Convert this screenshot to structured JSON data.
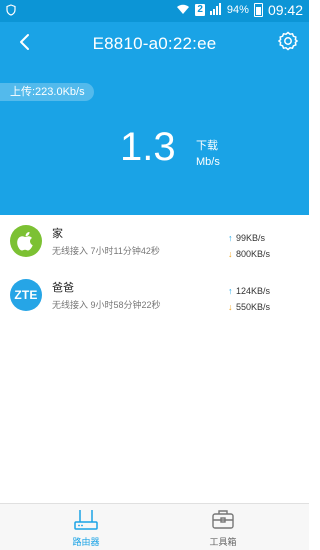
{
  "status_bar": {
    "sim_slot": "2",
    "battery": "94%",
    "time": "09:42"
  },
  "header": {
    "title": "E8810-a0:22:ee"
  },
  "hero": {
    "upload_text": "上传:223.0Kb/s",
    "download_value": "1.3",
    "download_label": "下载",
    "download_unit": "Mb/s"
  },
  "devices": [
    {
      "name": "家",
      "detail": "无线接入  7小时11分钟42秒",
      "up": "99KB/s",
      "down": "800KB/s",
      "icon": "apple-icon"
    },
    {
      "name": "爸爸",
      "detail": "无线接入  9小时58分钟22秒",
      "up": "124KB/s",
      "down": "550KB/s",
      "icon": "zte-logo",
      "logo_text": "ZTE"
    }
  ],
  "bottom_nav": {
    "router_label": "路由器",
    "toolbox_label": "工具箱"
  },
  "colors": {
    "primary": "#1aa3e6",
    "status_bar": "#0c95d6",
    "apple_green": "#7cc133",
    "upload_arrow": "#1aa3e6",
    "download_arrow": "#f2a31b"
  }
}
